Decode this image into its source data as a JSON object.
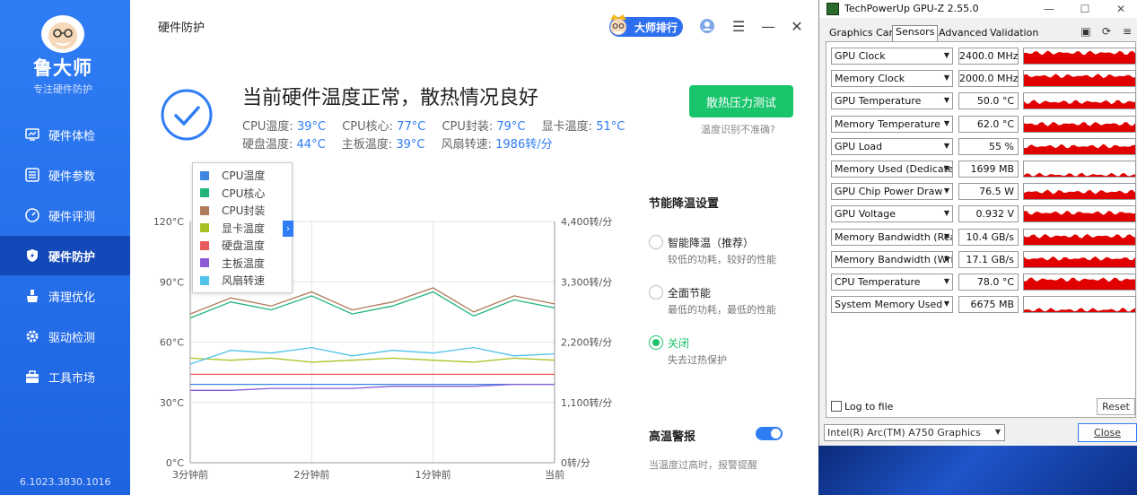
{
  "ludashi": {
    "brand": "鲁大师",
    "tagline": "专注硬件防护",
    "version": "6.1023.3830.1016",
    "page_title": "硬件防护",
    "rank_button": "大师排行",
    "nav": [
      {
        "label": "硬件体检",
        "icon": "monitor-icon"
      },
      {
        "label": "硬件参数",
        "icon": "list-icon"
      },
      {
        "label": "硬件评测",
        "icon": "gauge-icon"
      },
      {
        "label": "硬件防护",
        "icon": "shield-icon",
        "active": true
      },
      {
        "label": "清理优化",
        "icon": "broom-icon"
      },
      {
        "label": "驱动检测",
        "icon": "gear-icon"
      },
      {
        "label": "工具市场",
        "icon": "toolbox-icon"
      }
    ],
    "status": {
      "headline": "当前硬件温度正常，散热情况良好",
      "row1": [
        {
          "label": "CPU温度:",
          "value": "39°C"
        },
        {
          "label": "CPU核心:",
          "value": "77°C"
        },
        {
          "label": "CPU封装:",
          "value": "79°C"
        },
        {
          "label": "显卡温度:",
          "value": "51°C"
        }
      ],
      "row2": [
        {
          "label": "硬盘温度:",
          "value": "44°C"
        },
        {
          "label": "主板温度:",
          "value": "39°C"
        },
        {
          "label": "风扇转速:",
          "value": "1986转/分"
        }
      ]
    },
    "stress_button": "散热压力测试",
    "temp_inaccurate": "温度识别不准确?",
    "settings": {
      "title": "节能降温设置",
      "options": [
        {
          "label": "智能降温（推荐）",
          "desc": "较低的功耗，较好的性能",
          "checked": false
        },
        {
          "label": "全面节能",
          "desc": "最低的功耗，最低的性能",
          "checked": false
        },
        {
          "label": "关闭",
          "desc": "失去过热保护",
          "checked": true
        }
      ],
      "alarm_title": "高温警报",
      "alarm_on": true,
      "alarm_desc": "当温度过高时，报警提醒"
    }
  },
  "chart_data": {
    "type": "line",
    "x": [
      "3分钟前",
      "2分钟前",
      "1分钟前",
      "当前"
    ],
    "y_left_ticks": [
      "120°C",
      "90°C",
      "60°C",
      "30°C",
      "0°C"
    ],
    "y_right_ticks": [
      "4,400转/分",
      "3,300转/分",
      "2,200转/分",
      "1,100转/分",
      "0转/分"
    ],
    "ylim_left": [
      0,
      120
    ],
    "ylim_right": [
      0,
      4400
    ],
    "grid": true,
    "legend_position": "top-left",
    "series": [
      {
        "name": "CPU温度",
        "color": "#3a86e0",
        "values": [
          39,
          39,
          39,
          39,
          39,
          39,
          39,
          39,
          39,
          39
        ]
      },
      {
        "name": "CPU核心",
        "color": "#1fb57a",
        "values": [
          72,
          80,
          76,
          83,
          74,
          78,
          85,
          73,
          81,
          77
        ]
      },
      {
        "name": "CPU封装",
        "color": "#b07a5a",
        "values": [
          74,
          82,
          78,
          85,
          76,
          80,
          87,
          75,
          83,
          79
        ]
      },
      {
        "name": "显卡温度",
        "color": "#a8c020",
        "values": [
          52,
          51,
          52,
          50,
          51,
          52,
          51,
          50,
          52,
          51
        ]
      },
      {
        "name": "硬盘温度",
        "color": "#e85a5a",
        "values": [
          44,
          44,
          44,
          44,
          44,
          44,
          44,
          44,
          44,
          44
        ]
      },
      {
        "name": "主板温度",
        "color": "#8a5ad8",
        "values": [
          36,
          36,
          37,
          37,
          37,
          38,
          38,
          38,
          39,
          39
        ]
      },
      {
        "name": "风扇转速",
        "color": "#4fc3e8",
        "axis": "right",
        "values": [
          1800,
          2050,
          2000,
          2100,
          1950,
          2050,
          2000,
          2100,
          1950,
          1986
        ]
      }
    ]
  },
  "gpuz": {
    "title": "TechPowerUp GPU-Z 2.55.0",
    "tabs": [
      "Graphics Card",
      "Sensors",
      "Advanced",
      "Validation"
    ],
    "active_tab": "Sensors",
    "sensors": [
      {
        "name": "GPU Clock",
        "value": "2400.0 MHz",
        "level": 0.75
      },
      {
        "name": "Memory Clock",
        "value": "2000.0 MHz",
        "level": 0.7
      },
      {
        "name": "GPU Temperature",
        "value": "50.0 °C",
        "level": 0.45
      },
      {
        "name": "Memory Temperature",
        "value": "62.0 °C",
        "level": 0.55
      },
      {
        "name": "GPU Load",
        "value": "55 %",
        "level": 0.55
      },
      {
        "name": "Memory Used (Dedicated)",
        "value": "1699 MB",
        "level": 0.12
      },
      {
        "name": "GPU Chip Power Draw",
        "value": "76.5 W",
        "level": 0.5
      },
      {
        "name": "GPU Voltage",
        "value": "0.932 V",
        "level": 0.6
      },
      {
        "name": "Memory Bandwidth (Read)",
        "value": "10.4 GB/s",
        "level": 0.6
      },
      {
        "name": "Memory Bandwidth (Write)",
        "value": "17.1 GB/s",
        "level": 0.6
      },
      {
        "name": "CPU Temperature",
        "value": "78.0 °C",
        "level": 0.7
      },
      {
        "name": "System Memory Used",
        "value": "6675 MB",
        "level": 0.15
      }
    ],
    "log_to_file": "Log to file",
    "reset": "Reset",
    "device": "Intel(R) Arc(TM) A750 Graphics",
    "close": "Close",
    "graph_color": "#e00000"
  }
}
